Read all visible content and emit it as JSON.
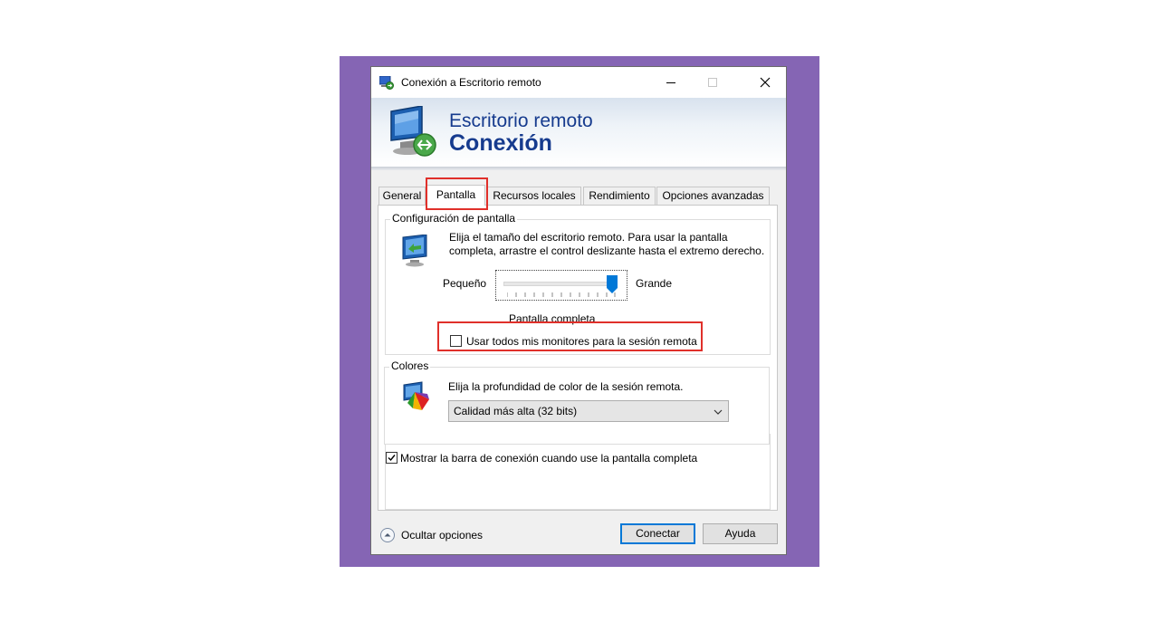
{
  "window": {
    "title": "Conexión a Escritorio remoto",
    "minimize_icon": "minimize-icon",
    "maximize_icon": "maximize-icon",
    "close_icon": "close-icon"
  },
  "banner": {
    "line1": "Escritorio remoto",
    "line2": "Conexión",
    "icon": "remote-desktop-icon"
  },
  "tabs": [
    {
      "label": "General",
      "active": false
    },
    {
      "label": "Pantalla",
      "active": true
    },
    {
      "label": "Recursos locales",
      "active": false
    },
    {
      "label": "Rendimiento",
      "active": false
    },
    {
      "label": "Opciones avanzadas",
      "active": false
    }
  ],
  "display": {
    "group_label": "Configuración de pantalla",
    "description_line1": "Elija el tamaño del escritorio remoto. Para usar la pantalla",
    "description_line2": "completa, arrastre el control deslizante hasta el extremo derecho.",
    "slider_min_label": "Pequeño",
    "slider_max_label": "Grande",
    "slider_value_label": "Pantalla completa",
    "slider_level": 1.0,
    "monitors_checkbox_label": "Usar todos mis monitores para la sesión remota",
    "monitors_checked": false
  },
  "colors": {
    "group_label": "Colores",
    "description": "Elija la profundidad de color de la sesión remota.",
    "selected": "Calidad más alta (32 bits)"
  },
  "connection_bar": {
    "label": "Mostrar la barra de conexión cuando use la pantalla completa",
    "checked": true
  },
  "footer": {
    "hide_options": "Ocultar opciones",
    "connect": "Conectar",
    "help": "Ayuda"
  },
  "theme": {
    "accent": "#0078d7",
    "banner_text": "#163b8e",
    "highlight": "#e0302a",
    "backdrop": "#8565b4"
  }
}
